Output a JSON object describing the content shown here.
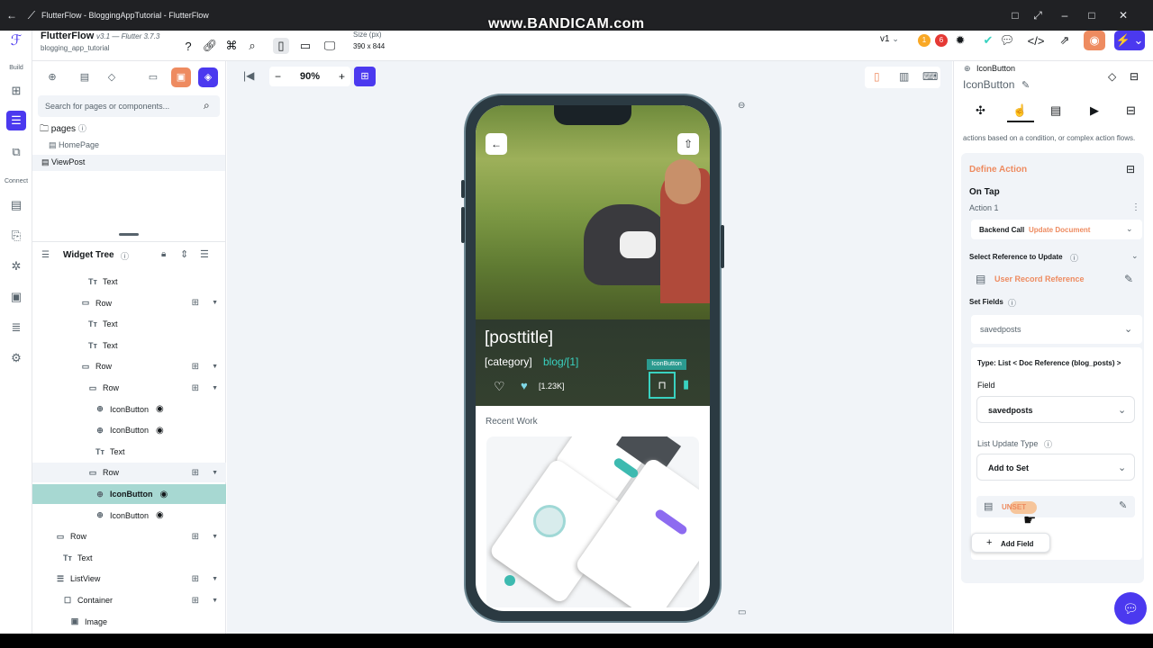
{
  "window": {
    "title": "FlutterFlow - BloggingAppTutorial - FlutterFlow"
  },
  "watermark": "www.BANDICAM.com",
  "rail": {
    "build_label": "Build",
    "connect_label": "Connect"
  },
  "header": {
    "app_name": "FlutterFlow",
    "version": "v3.1",
    "flutter_version": "— Flutter 3.7.3",
    "project_name": "blogging_app_tutorial",
    "size_label": "Size (px)",
    "size_value": "390 x 844",
    "version_select": "v1",
    "badge_warn": "1",
    "badge_err": "6"
  },
  "left": {
    "search_placeholder": "Search for pages or components...",
    "pages_label": "pages",
    "pages": [
      "HomePage",
      "ViewPost"
    ],
    "widget_tree_label": "Widget Tree",
    "tree": [
      {
        "indent": 60,
        "icon": "Tт",
        "label": "Text",
        "tools": false
      },
      {
        "indent": 52,
        "icon": "▭",
        "label": "Row",
        "tools": true
      },
      {
        "indent": 60,
        "icon": "Tт",
        "label": "Text",
        "tools": false
      },
      {
        "indent": 60,
        "icon": "Tт",
        "label": "Text",
        "tools": false
      },
      {
        "indent": 52,
        "icon": "▭",
        "label": "Row",
        "tools": true
      },
      {
        "indent": 60,
        "icon": "▭",
        "label": "Row",
        "tools": true
      },
      {
        "indent": 68,
        "icon": "⊕",
        "label": "IconButton",
        "tools": false
      },
      {
        "indent": 68,
        "icon": "⊕",
        "label": "IconButton",
        "tools": false
      },
      {
        "indent": 68,
        "icon": "Tт",
        "label": "Text",
        "tools": false
      },
      {
        "indent": 60,
        "icon": "▭",
        "label": "Row",
        "tools": true
      },
      {
        "indent": 68,
        "icon": "⊕",
        "label": "IconButton",
        "tools": false
      },
      {
        "indent": 68,
        "icon": "⊕",
        "label": "IconButton",
        "tools": false
      },
      {
        "indent": 24,
        "icon": "▭",
        "label": "Row",
        "tools": true
      },
      {
        "indent": 32,
        "icon": "Tт",
        "label": "Text",
        "tools": false
      },
      {
        "indent": 24,
        "icon": "☰",
        "label": "ListView",
        "tools": true
      },
      {
        "indent": 32,
        "icon": "☐",
        "label": "Container",
        "tools": true
      },
      {
        "indent": 40,
        "icon": "▣",
        "label": "Image",
        "tools": false
      }
    ]
  },
  "canvas": {
    "zoom": "90%"
  },
  "phone": {
    "post_title": "[posttitle]",
    "category": "[category]",
    "blog_ref": "blog/[1]",
    "likes": "[1.23K]",
    "tooltip": "IconButton",
    "recent_work": "Recent Work"
  },
  "right": {
    "widget_type": "IconButton",
    "widget_name": "IconButton",
    "hint_text": "actions based on a condition, or complex action flows.",
    "define_action": "Define Action",
    "on_tap": "On Tap",
    "action1": "Action 1",
    "backend_call": "Backend Call",
    "update_document": "Update Document",
    "select_ref_label": "Select Reference to Update",
    "user_record_ref": "User Record Reference",
    "set_fields_label": "Set Fields",
    "field_select": "savedposts",
    "type_label": "Type: List < Doc Reference (blog_posts) >",
    "field_label": "Field",
    "field_value": "savedposts",
    "list_update_label": "List Update Type",
    "list_update_value": "Add to Set",
    "unset": "UNSET",
    "add_field": "Add Field"
  },
  "colors": {
    "accent": "#4b39ef",
    "orange": "#ee8b60",
    "teal": "#39d2c0",
    "selected": "#a7d8d2"
  }
}
